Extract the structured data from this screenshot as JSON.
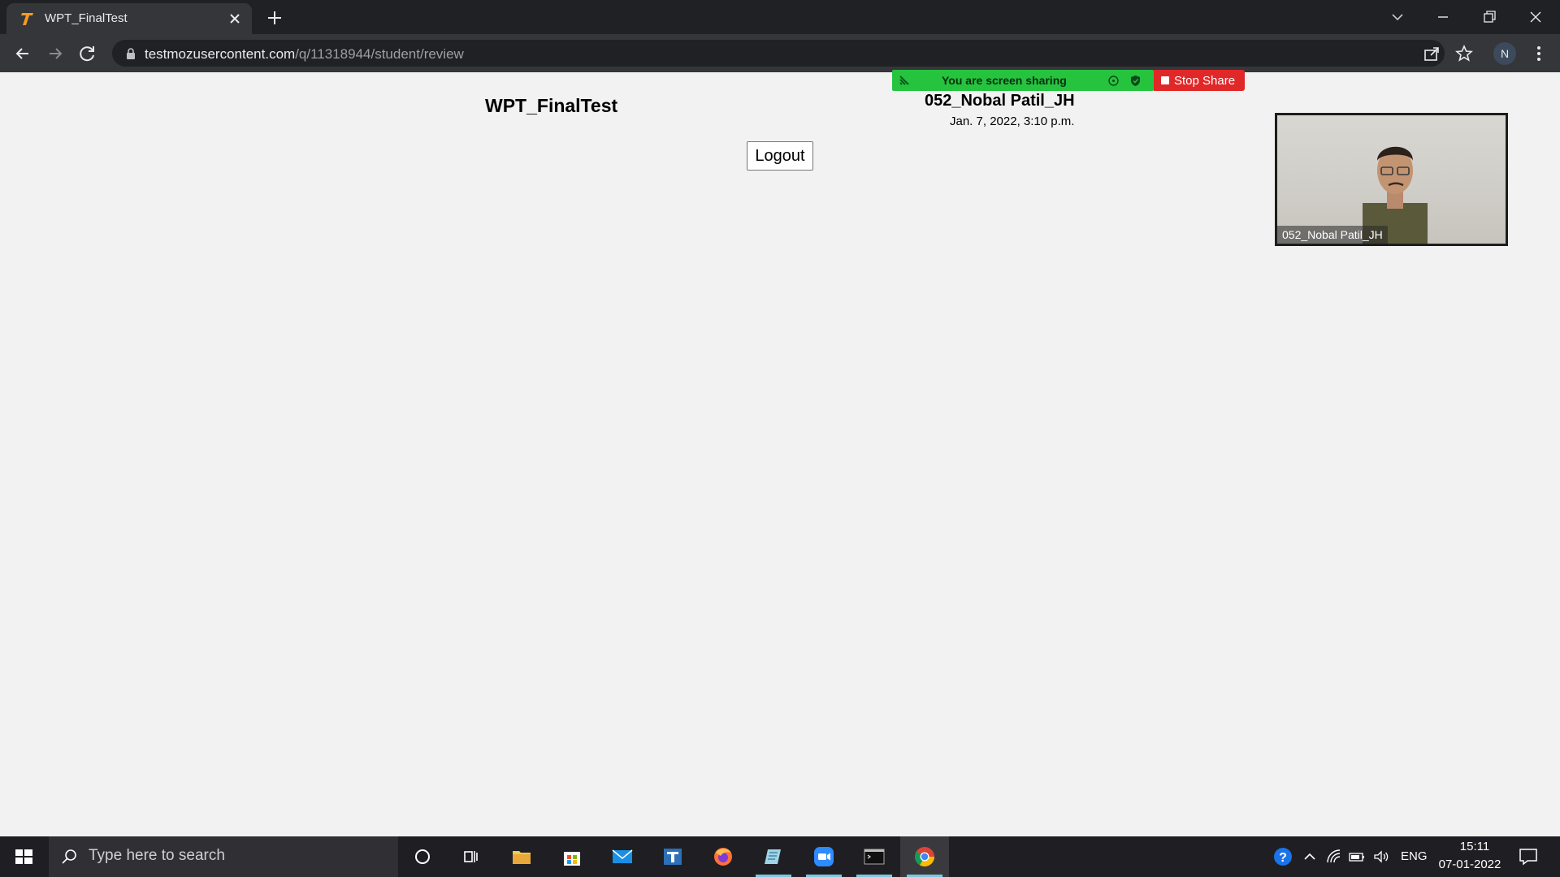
{
  "browser": {
    "tab_title": "WPT_FinalTest",
    "url_host": "testmozusercontent.com",
    "url_path": "/q/11318944/student/review",
    "profile_initial": "N"
  },
  "page": {
    "quiz_title": "WPT_FinalTest",
    "student_name": "052_Nobal Patil_JH",
    "submitted_at": "Jan. 7, 2022, 3:10 p.m.",
    "logout_label": "Logout"
  },
  "zoom": {
    "share_status": "You are screen sharing",
    "stop_share_label": "Stop Share",
    "video_label": "052_Nobal Patil_JH",
    "share_color": "#26c33f",
    "stop_color": "#e02828"
  },
  "taskbar": {
    "search_placeholder": "Type here to search",
    "apps": [
      "cortana-icon",
      "task-view-icon",
      "file-explorer-icon",
      "store-icon",
      "mail-icon",
      "app-icon",
      "firefox-icon",
      "app-icon-2",
      "zoom-icon",
      "terminal-icon",
      "chrome-icon"
    ],
    "language": "ENG",
    "time": "15:11",
    "date": "07-01-2022"
  }
}
